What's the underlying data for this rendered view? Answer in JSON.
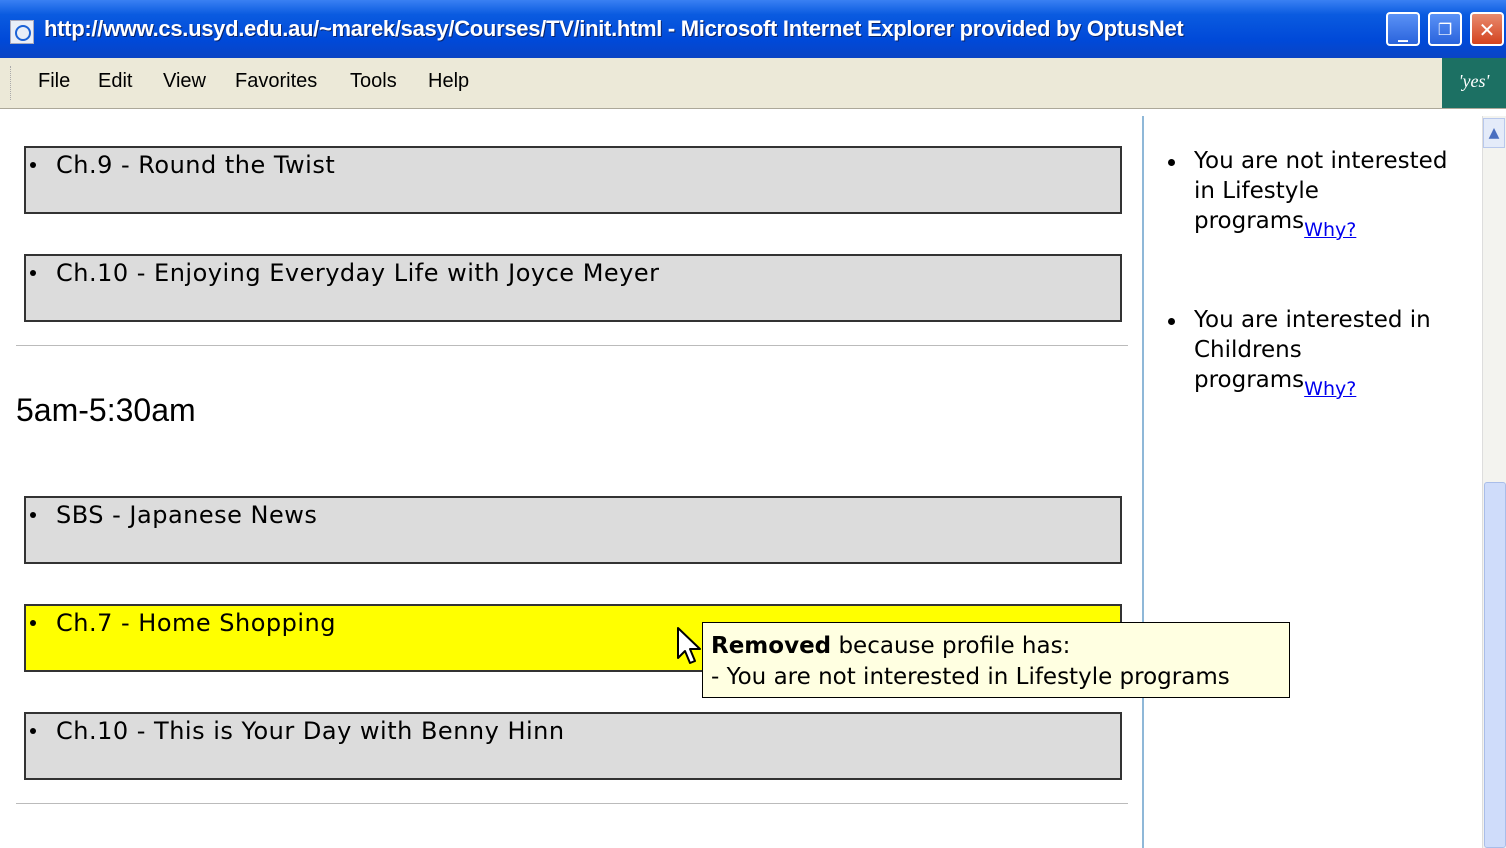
{
  "window": {
    "title": "http://www.cs.usyd.edu.au/~marek/sasy/Courses/TV/init.html - Microsoft Internet Explorer provided by OptusNet"
  },
  "menu": {
    "items": [
      "File",
      "Edit",
      "View",
      "Favorites",
      "Tools",
      "Help"
    ],
    "brand": "'yes'"
  },
  "programs_top": [
    {
      "label": "Ch.9 - Round the Twist"
    },
    {
      "label": "Ch.10 - Enjoying Everyday Life with Joyce Meyer"
    }
  ],
  "timeslot": "5am-5:30am",
  "programs_bottom": [
    {
      "label": "SBS - Japanese News",
      "highlighted": false
    },
    {
      "label": "Ch.7 - Home Shopping",
      "highlighted": true
    },
    {
      "label": "Ch.10 - This is Your Day with Benny Hinn",
      "highlighted": false
    }
  ],
  "tooltip": {
    "bold": "Removed",
    "rest": " because profile has:",
    "line2": "- You are not interested in Lifestyle programs"
  },
  "sidebar": {
    "items": [
      {
        "text": "You are not interested in Lifestyle programs",
        "link": "Why?"
      },
      {
        "text": "You are interested in Childrens programs",
        "link": "Why?"
      }
    ]
  },
  "colors": {
    "highlight": "#ffff00",
    "program_bg": "#dcdcdc",
    "titlebar": "#0049d8",
    "link": "#0000ee"
  }
}
